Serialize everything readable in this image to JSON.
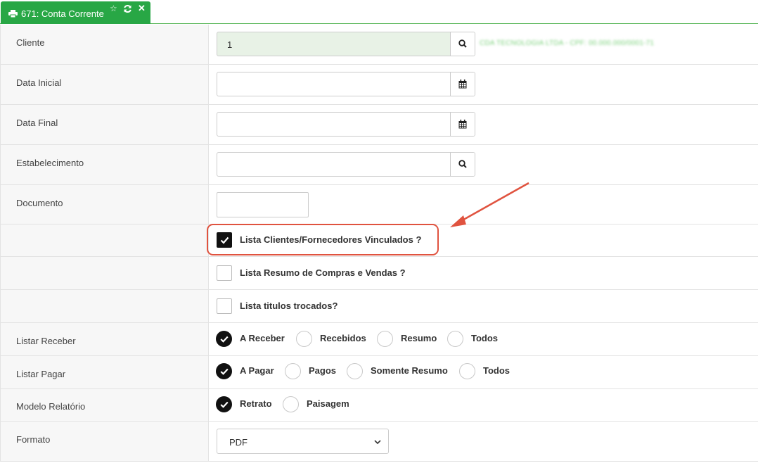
{
  "tab": {
    "title": "671: Conta Corrente",
    "icons": [
      "print-icon",
      "star-icon",
      "refresh-icon",
      "close-icon"
    ]
  },
  "fields": {
    "cliente": {
      "label": "Cliente",
      "value": "1",
      "name_display": "CDA TECNOLOGIA LTDA - CPF: 00.000.000/0001-71"
    },
    "data_inicial": {
      "label": "Data Inicial",
      "value": ""
    },
    "data_final": {
      "label": "Data Final",
      "value": ""
    },
    "estabelecimento": {
      "label": "Estabelecimento",
      "value": ""
    },
    "documento": {
      "label": "Documento",
      "value": ""
    }
  },
  "checkboxes": [
    {
      "label": "Lista Clientes/Fornecedores Vinculados ?",
      "checked": true
    },
    {
      "label": "Lista Resumo de Compras e Vendas ?",
      "checked": false
    },
    {
      "label": "Lista titulos trocados?",
      "checked": false
    }
  ],
  "listar_receber": {
    "label": "Listar Receber",
    "options": [
      "A Receber",
      "Recebidos",
      "Resumo",
      "Todos"
    ],
    "selected": "A Receber"
  },
  "listar_pagar": {
    "label": "Listar Pagar",
    "options": [
      "A Pagar",
      "Pagos",
      "Somente Resumo",
      "Todos"
    ],
    "selected": "A Pagar"
  },
  "modelo_relatorio": {
    "label": "Modelo Relatório",
    "options": [
      "Retrato",
      "Paisagem"
    ],
    "selected": "Retrato"
  },
  "formato": {
    "label": "Formato",
    "selected": "PDF"
  },
  "colors": {
    "tab_green": "#28a745",
    "filled_input": "#e8f2e6",
    "annotation_red": "#e0533f"
  }
}
